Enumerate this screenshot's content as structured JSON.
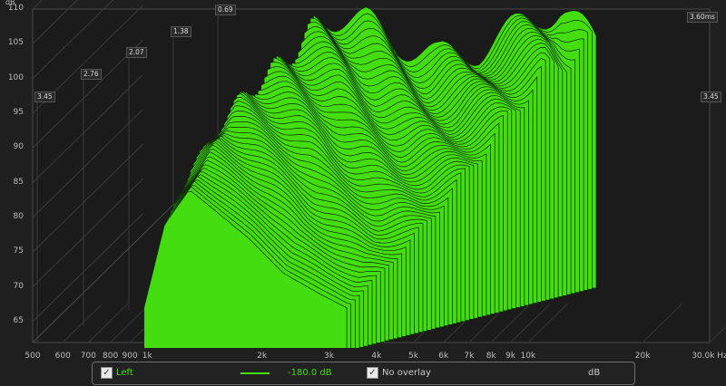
{
  "chart_data": {
    "type": "area",
    "subtype": "waterfall-3d",
    "y_unit": "dB",
    "x_unit": "Hz",
    "y_ticks": [
      "110",
      "105",
      "100",
      "95",
      "90",
      "85",
      "80",
      "75",
      "70",
      "65"
    ],
    "x_ticks": [
      "500",
      "600",
      "700",
      "800",
      "900",
      "1k",
      "2k",
      "3k",
      "4k",
      "5k",
      "6k",
      "7k",
      "8k",
      "9k",
      "10k",
      "20k",
      "30.0k Hz"
    ],
    "time_labels": [
      "3.45",
      "2.76",
      "2.07",
      "1.38",
      "0.69",
      "3.60ms",
      "3.45"
    ],
    "xlim": [
      500,
      30000
    ],
    "ylim": [
      62,
      110
    ],
    "series_color": "#44dd0f",
    "slices": 60,
    "front_profile_points": [
      {
        "x": 900,
        "y": 67
      },
      {
        "x": 1100,
        "y": 79
      },
      {
        "x": 1400,
        "y": 84
      },
      {
        "x": 1800,
        "y": 81
      },
      {
        "x": 2500,
        "y": 77
      },
      {
        "x": 3500,
        "y": 72
      },
      {
        "x": 5000,
        "y": 69
      },
      {
        "x": 6500,
        "y": 67
      }
    ],
    "back_profile_points": [
      {
        "x": 2000,
        "y": 100
      },
      {
        "x": 3000,
        "y": 99
      },
      {
        "x": 4000,
        "y": 96
      },
      {
        "x": 6000,
        "y": 94
      },
      {
        "x": 9000,
        "y": 95
      },
      {
        "x": 14000,
        "y": 99
      },
      {
        "x": 20000,
        "y": 101
      },
      {
        "x": 28000,
        "y": 96
      }
    ]
  },
  "legend": {
    "left_label": "Left",
    "left_checked": true,
    "level_value": "-180.0 dB",
    "overlay_label": "No overlay",
    "overlay_checked": true,
    "unit_label": "dB"
  }
}
